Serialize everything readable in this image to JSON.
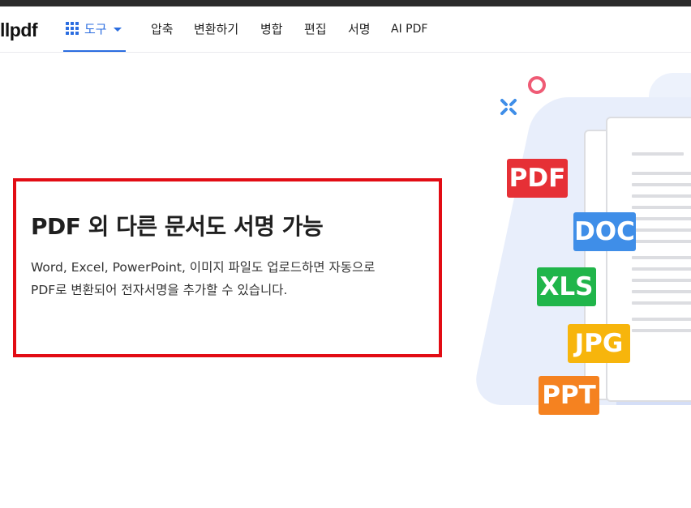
{
  "header": {
    "logo_text": "llpdf",
    "tools_label": "도구",
    "nav_items": [
      "압축",
      "변환하기",
      "병합",
      "편집",
      "서명",
      "AI PDF"
    ]
  },
  "main": {
    "heading": "PDF 외 다른 문서도 서명 가능",
    "description_line1": "Word, Excel, PowerPoint, 이미지 파일도 업로드하면 자동으로",
    "description_line2": "PDF로 변환되어 전자서명을 추가할 수 있습니다."
  },
  "illustration": {
    "badges": [
      {
        "label": "PDF",
        "color": "#e63036"
      },
      {
        "label": "DOC",
        "color": "#3f8ee8"
      },
      {
        "label": "XLS",
        "color": "#20b54a"
      },
      {
        "label": "JPG",
        "color": "#f7b50c"
      },
      {
        "label": "PPT",
        "color": "#f58220"
      }
    ]
  },
  "colors": {
    "accent": "#2b6de0",
    "highlight_border": "#e20c14"
  }
}
